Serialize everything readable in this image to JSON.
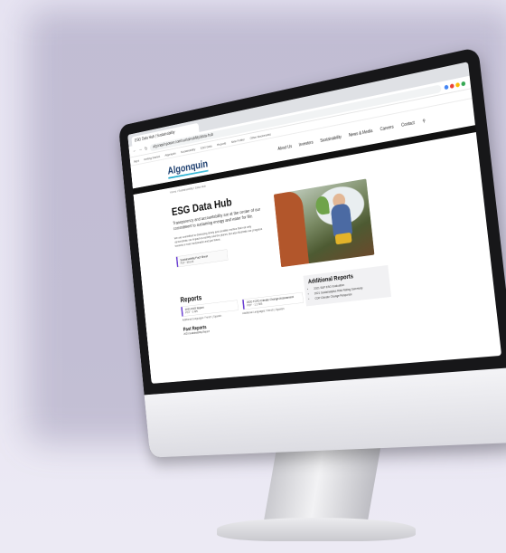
{
  "browser": {
    "tab_title": "ESG Data Hub | Sustainability",
    "url": "algonquinpower.com/sustainability/data-hub",
    "bookmarks": [
      "Apps",
      "Getting Started",
      "Algonquin",
      "Sustainability",
      "ESG Data",
      "Reports",
      "New Folder",
      "Other Bookmarks"
    ],
    "extension_colors": [
      "#4285f4",
      "#ea4335",
      "#fbbc05",
      "#34a853"
    ]
  },
  "site": {
    "logo": "Algonquin",
    "nav": [
      "About Us",
      "Investors",
      "Sustainability",
      "News & Media",
      "Careers",
      "Contact"
    ],
    "breadcrumb": "Home  /  Sustainability  /  Data Hub"
  },
  "hero": {
    "title": "ESG Data Hub",
    "lede": "Transparency and accountability are at the center of our commitment to sustaining energy and water for life.",
    "body": "We are committed to disclosing timely and credible metrics that not only demonstrate our impact on society and the planet, but also illustrate our progress towards a more sustainable and just future.",
    "fact_sheet_label": "Sustainability Fact Sheet",
    "fact_sheet_meta": "PDF · 653 kB"
  },
  "reports": {
    "heading": "Reports",
    "cards": [
      {
        "title": "2021 ESG Report",
        "meta": "PDF · 6 MB",
        "languages": "Additional Languages: French | Spanish"
      },
      {
        "title": "2020 TCFD Climate Change Assessment",
        "meta": "PDF · 1.2 MB",
        "languages": "Additional Languages: French | Spanish"
      }
    ],
    "past_heading": "Past Reports",
    "past_items": [
      "2020 Sustainability Report"
    ]
  },
  "additional": {
    "heading": "Additional Reports",
    "items": [
      "2021 S&P ESG Evaluation",
      "2021 Sustainalytics Risk Rating Summary",
      "CDP Climate Change Response"
    ]
  }
}
